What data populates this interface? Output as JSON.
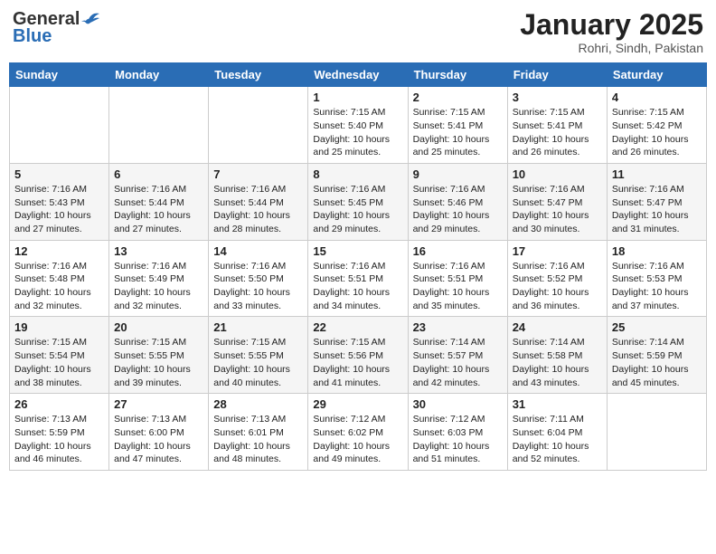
{
  "logo": {
    "general": "General",
    "blue": "Blue"
  },
  "title": "January 2025",
  "subtitle": "Rohri, Sindh, Pakistan",
  "days_of_week": [
    "Sunday",
    "Monday",
    "Tuesday",
    "Wednesday",
    "Thursday",
    "Friday",
    "Saturday"
  ],
  "weeks": [
    [
      {
        "day": "",
        "info": ""
      },
      {
        "day": "",
        "info": ""
      },
      {
        "day": "",
        "info": ""
      },
      {
        "day": "1",
        "info": "Sunrise: 7:15 AM\nSunset: 5:40 PM\nDaylight: 10 hours\nand 25 minutes."
      },
      {
        "day": "2",
        "info": "Sunrise: 7:15 AM\nSunset: 5:41 PM\nDaylight: 10 hours\nand 25 minutes."
      },
      {
        "day": "3",
        "info": "Sunrise: 7:15 AM\nSunset: 5:41 PM\nDaylight: 10 hours\nand 26 minutes."
      },
      {
        "day": "4",
        "info": "Sunrise: 7:15 AM\nSunset: 5:42 PM\nDaylight: 10 hours\nand 26 minutes."
      }
    ],
    [
      {
        "day": "5",
        "info": "Sunrise: 7:16 AM\nSunset: 5:43 PM\nDaylight: 10 hours\nand 27 minutes."
      },
      {
        "day": "6",
        "info": "Sunrise: 7:16 AM\nSunset: 5:44 PM\nDaylight: 10 hours\nand 27 minutes."
      },
      {
        "day": "7",
        "info": "Sunrise: 7:16 AM\nSunset: 5:44 PM\nDaylight: 10 hours\nand 28 minutes."
      },
      {
        "day": "8",
        "info": "Sunrise: 7:16 AM\nSunset: 5:45 PM\nDaylight: 10 hours\nand 29 minutes."
      },
      {
        "day": "9",
        "info": "Sunrise: 7:16 AM\nSunset: 5:46 PM\nDaylight: 10 hours\nand 29 minutes."
      },
      {
        "day": "10",
        "info": "Sunrise: 7:16 AM\nSunset: 5:47 PM\nDaylight: 10 hours\nand 30 minutes."
      },
      {
        "day": "11",
        "info": "Sunrise: 7:16 AM\nSunset: 5:47 PM\nDaylight: 10 hours\nand 31 minutes."
      }
    ],
    [
      {
        "day": "12",
        "info": "Sunrise: 7:16 AM\nSunset: 5:48 PM\nDaylight: 10 hours\nand 32 minutes."
      },
      {
        "day": "13",
        "info": "Sunrise: 7:16 AM\nSunset: 5:49 PM\nDaylight: 10 hours\nand 32 minutes."
      },
      {
        "day": "14",
        "info": "Sunrise: 7:16 AM\nSunset: 5:50 PM\nDaylight: 10 hours\nand 33 minutes."
      },
      {
        "day": "15",
        "info": "Sunrise: 7:16 AM\nSunset: 5:51 PM\nDaylight: 10 hours\nand 34 minutes."
      },
      {
        "day": "16",
        "info": "Sunrise: 7:16 AM\nSunset: 5:51 PM\nDaylight: 10 hours\nand 35 minutes."
      },
      {
        "day": "17",
        "info": "Sunrise: 7:16 AM\nSunset: 5:52 PM\nDaylight: 10 hours\nand 36 minutes."
      },
      {
        "day": "18",
        "info": "Sunrise: 7:16 AM\nSunset: 5:53 PM\nDaylight: 10 hours\nand 37 minutes."
      }
    ],
    [
      {
        "day": "19",
        "info": "Sunrise: 7:15 AM\nSunset: 5:54 PM\nDaylight: 10 hours\nand 38 minutes."
      },
      {
        "day": "20",
        "info": "Sunrise: 7:15 AM\nSunset: 5:55 PM\nDaylight: 10 hours\nand 39 minutes."
      },
      {
        "day": "21",
        "info": "Sunrise: 7:15 AM\nSunset: 5:55 PM\nDaylight: 10 hours\nand 40 minutes."
      },
      {
        "day": "22",
        "info": "Sunrise: 7:15 AM\nSunset: 5:56 PM\nDaylight: 10 hours\nand 41 minutes."
      },
      {
        "day": "23",
        "info": "Sunrise: 7:14 AM\nSunset: 5:57 PM\nDaylight: 10 hours\nand 42 minutes."
      },
      {
        "day": "24",
        "info": "Sunrise: 7:14 AM\nSunset: 5:58 PM\nDaylight: 10 hours\nand 43 minutes."
      },
      {
        "day": "25",
        "info": "Sunrise: 7:14 AM\nSunset: 5:59 PM\nDaylight: 10 hours\nand 45 minutes."
      }
    ],
    [
      {
        "day": "26",
        "info": "Sunrise: 7:13 AM\nSunset: 5:59 PM\nDaylight: 10 hours\nand 46 minutes."
      },
      {
        "day": "27",
        "info": "Sunrise: 7:13 AM\nSunset: 6:00 PM\nDaylight: 10 hours\nand 47 minutes."
      },
      {
        "day": "28",
        "info": "Sunrise: 7:13 AM\nSunset: 6:01 PM\nDaylight: 10 hours\nand 48 minutes."
      },
      {
        "day": "29",
        "info": "Sunrise: 7:12 AM\nSunset: 6:02 PM\nDaylight: 10 hours\nand 49 minutes."
      },
      {
        "day": "30",
        "info": "Sunrise: 7:12 AM\nSunset: 6:03 PM\nDaylight: 10 hours\nand 51 minutes."
      },
      {
        "day": "31",
        "info": "Sunrise: 7:11 AM\nSunset: 6:04 PM\nDaylight: 10 hours\nand 52 minutes."
      },
      {
        "day": "",
        "info": ""
      }
    ]
  ]
}
